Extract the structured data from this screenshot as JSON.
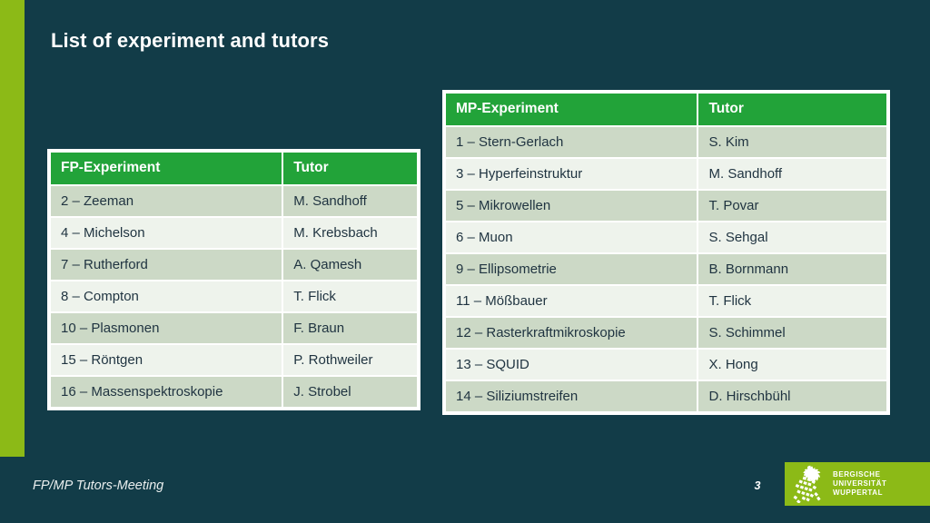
{
  "slide": {
    "title": "List of experiment and tutors",
    "background_color": "#123c48",
    "accent_color": "#8cba17",
    "header_color": "#22a339"
  },
  "fp_table": {
    "columns": [
      "FP-Experiment",
      "Tutor"
    ],
    "rows": [
      [
        "2 – Zeeman",
        "M. Sandhoff"
      ],
      [
        "4 – Michelson",
        "M. Krebsbach"
      ],
      [
        "7 – Rutherford",
        "A. Qamesh"
      ],
      [
        "8 – Compton",
        "T. Flick"
      ],
      [
        "10 – Plasmonen",
        "F. Braun"
      ],
      [
        "15 – Röntgen",
        "P. Rothweiler"
      ],
      [
        "16 – Massenspektroskopie",
        "J. Strobel"
      ]
    ]
  },
  "mp_table": {
    "columns": [
      "MP-Experiment",
      "Tutor"
    ],
    "rows": [
      [
        "1 – Stern-Gerlach",
        "S. Kim"
      ],
      [
        "3 – Hyperfeinstruktur",
        "M. Sandhoff"
      ],
      [
        "5 – Mikrowellen",
        "T. Povar"
      ],
      [
        "6 – Muon",
        "S. Sehgal"
      ],
      [
        "9 – Ellipsometrie",
        "B. Bornmann"
      ],
      [
        "11 – Mößbauer",
        "T. Flick"
      ],
      [
        "12 – Rasterkraftmikroskopie",
        "S. Schimmel"
      ],
      [
        "13 – SQUID",
        "X. Hong"
      ],
      [
        "14 – Siliziumstreifen",
        "D. Hirschbühl"
      ]
    ]
  },
  "footer": {
    "label": "FP/MP Tutors-Meeting",
    "page_number": "3"
  },
  "logo": {
    "emblem": "bergisch-lion-icon",
    "line1": "BERGISCHE",
    "line2": "UNIVERSITÄT",
    "line3": "WUPPERTAL"
  }
}
